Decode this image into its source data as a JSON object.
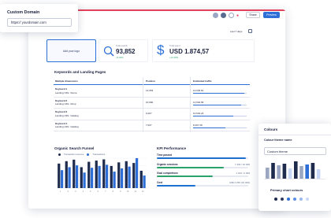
{
  "header": {
    "share_label": "Share",
    "preview_label": "Preview",
    "date_range": "Last 7 days"
  },
  "logo_placeholder": "Add your logo",
  "kpis": [
    {
      "label": "Total search",
      "value": "93,852",
      "change": "+5.34%",
      "icon": "search-icon"
    },
    {
      "label": "Total spent",
      "value": "USD 1.874,57",
      "change": "+12.26%",
      "icon": "dollar-icon"
    }
  ],
  "keywords": {
    "title": "Keywords and Landing Pages",
    "columns": [
      "Multiple dimensions",
      "Position",
      "Estimated traffic"
    ],
    "rows": [
      {
        "keyword": "Keyword 1",
        "landing": "Landing URL: /home",
        "position": "13,053",
        "traffic": "13,046,81",
        "fill": 0.95
      },
      {
        "keyword": "Keyword 2",
        "landing": "Landing URL: /shop",
        "position": "10,660",
        "traffic": "12,602,58",
        "fill": 0.9
      },
      {
        "keyword": "Keyword 3",
        "landing": "Landing URL: /catalog",
        "position": "9,207",
        "traffic": "10,604,24",
        "fill": 0.75
      },
      {
        "keyword": "Keyword 4",
        "landing": "Landing URL: /catalog",
        "position": "7,007",
        "traffic": "8,467,28",
        "fill": 0.6
      }
    ]
  },
  "funnel": {
    "title": "Organic Search Funnel",
    "legend": [
      "Transaction revenue",
      "Transactions"
    ]
  },
  "kpi_perf": {
    "title": "KPI Performance",
    "rows": [
      {
        "label": "Time passed",
        "value": "",
        "fill": 0.97,
        "color": "#1d6fd0"
      },
      {
        "label": "Organic sessions",
        "value": "7 330 / 10 000",
        "fill": 0.73,
        "color": "#2aa36b"
      },
      {
        "label": "Goal completions",
        "value": "1 222 / 2 000",
        "fill": 0.61,
        "color": "#2aa36b"
      },
      {
        "label": "Cost",
        "value": "US$ 4 256 (15 000)",
        "fill": 0.42,
        "color": "#1d6fd0"
      }
    ]
  },
  "chart_data": {
    "type": "bar",
    "title": "Organic Search Funnel",
    "categories": [
      "1",
      "2",
      "3",
      "4",
      "5",
      "6",
      "7",
      "8",
      "9",
      "10",
      "11",
      "12"
    ],
    "series": [
      {
        "name": "Transaction revenue",
        "values": [
          82,
          90,
          95,
          70,
          88,
          92,
          96,
          74,
          86,
          90,
          84,
          58
        ]
      },
      {
        "name": "Transactions",
        "values": [
          60,
          70,
          76,
          52,
          68,
          74,
          78,
          55,
          66,
          72,
          100,
          42
        ]
      }
    ],
    "colors": [
      "#1e2b4d",
      "#2d6fd6"
    ]
  },
  "domain_popup": {
    "title": "Custom Domain",
    "value": "https:// yourdomain.com"
  },
  "colours_popup": {
    "title": "Colours",
    "theme_label": "Colour theme name",
    "theme_value": "Custom theme",
    "primary_label": "Primary chart colours",
    "swatches": [
      "#1e2b4d",
      "#2d3a60",
      "#2d6fd6",
      "#5b8fe6",
      "#9bb8ef",
      "#c8d7f5"
    ],
    "preview_bars": [
      14,
      20,
      17,
      19,
      13,
      22,
      16,
      18,
      20,
      12
    ]
  }
}
